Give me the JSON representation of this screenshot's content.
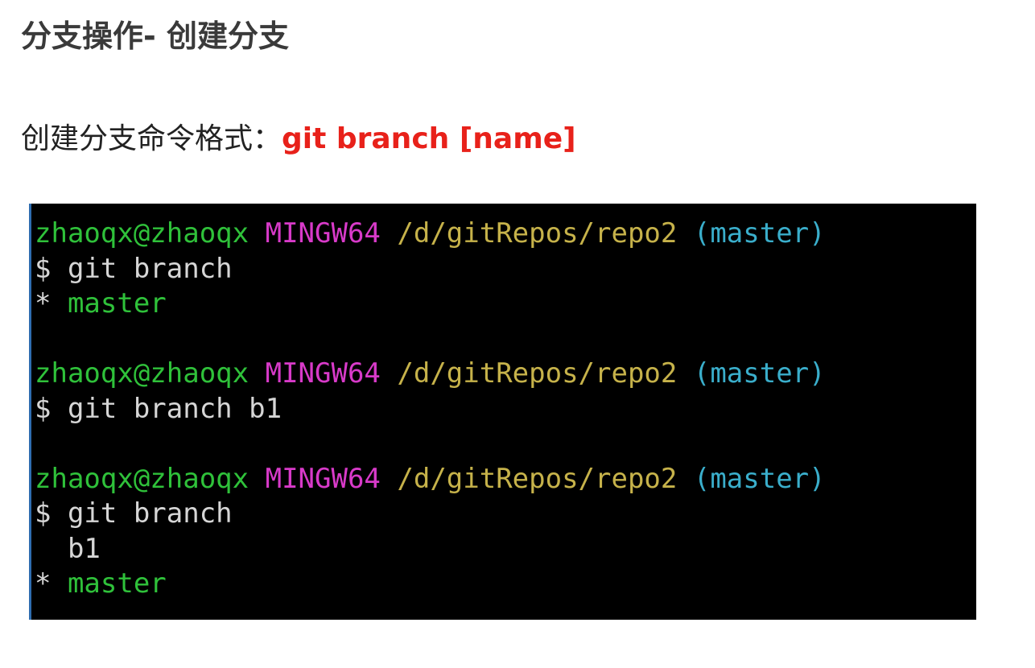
{
  "title": "分支操作- 创建分支",
  "format": {
    "label": "创建分支命令格式：",
    "command": "git branch [name]"
  },
  "terminal": {
    "colors": {
      "user": "#2fc13a",
      "system": "#d83ac9",
      "path": "#c6b24a",
      "branch": "#3aaecb",
      "text": "#d6d6d6",
      "background": "#000000"
    },
    "blocks": [
      {
        "user_host": "zhaoqx@zhaoqx",
        "system": "MINGW64",
        "path": "/d/gitRepos/repo2",
        "branch": "(master)",
        "command": "$ git branch",
        "output": [
          {
            "marker": "* ",
            "text": "master",
            "current": true
          }
        ]
      },
      {
        "user_host": "zhaoqx@zhaoqx",
        "system": "MINGW64",
        "path": "/d/gitRepos/repo2",
        "branch": "(master)",
        "command": "$ git branch b1",
        "output": []
      },
      {
        "user_host": "zhaoqx@zhaoqx",
        "system": "MINGW64",
        "path": "/d/gitRepos/repo2",
        "branch": "(master)",
        "command": "$ git branch",
        "output": [
          {
            "marker": "  ",
            "text": "b1",
            "current": false
          },
          {
            "marker": "* ",
            "text": "master",
            "current": true
          }
        ]
      }
    ]
  }
}
